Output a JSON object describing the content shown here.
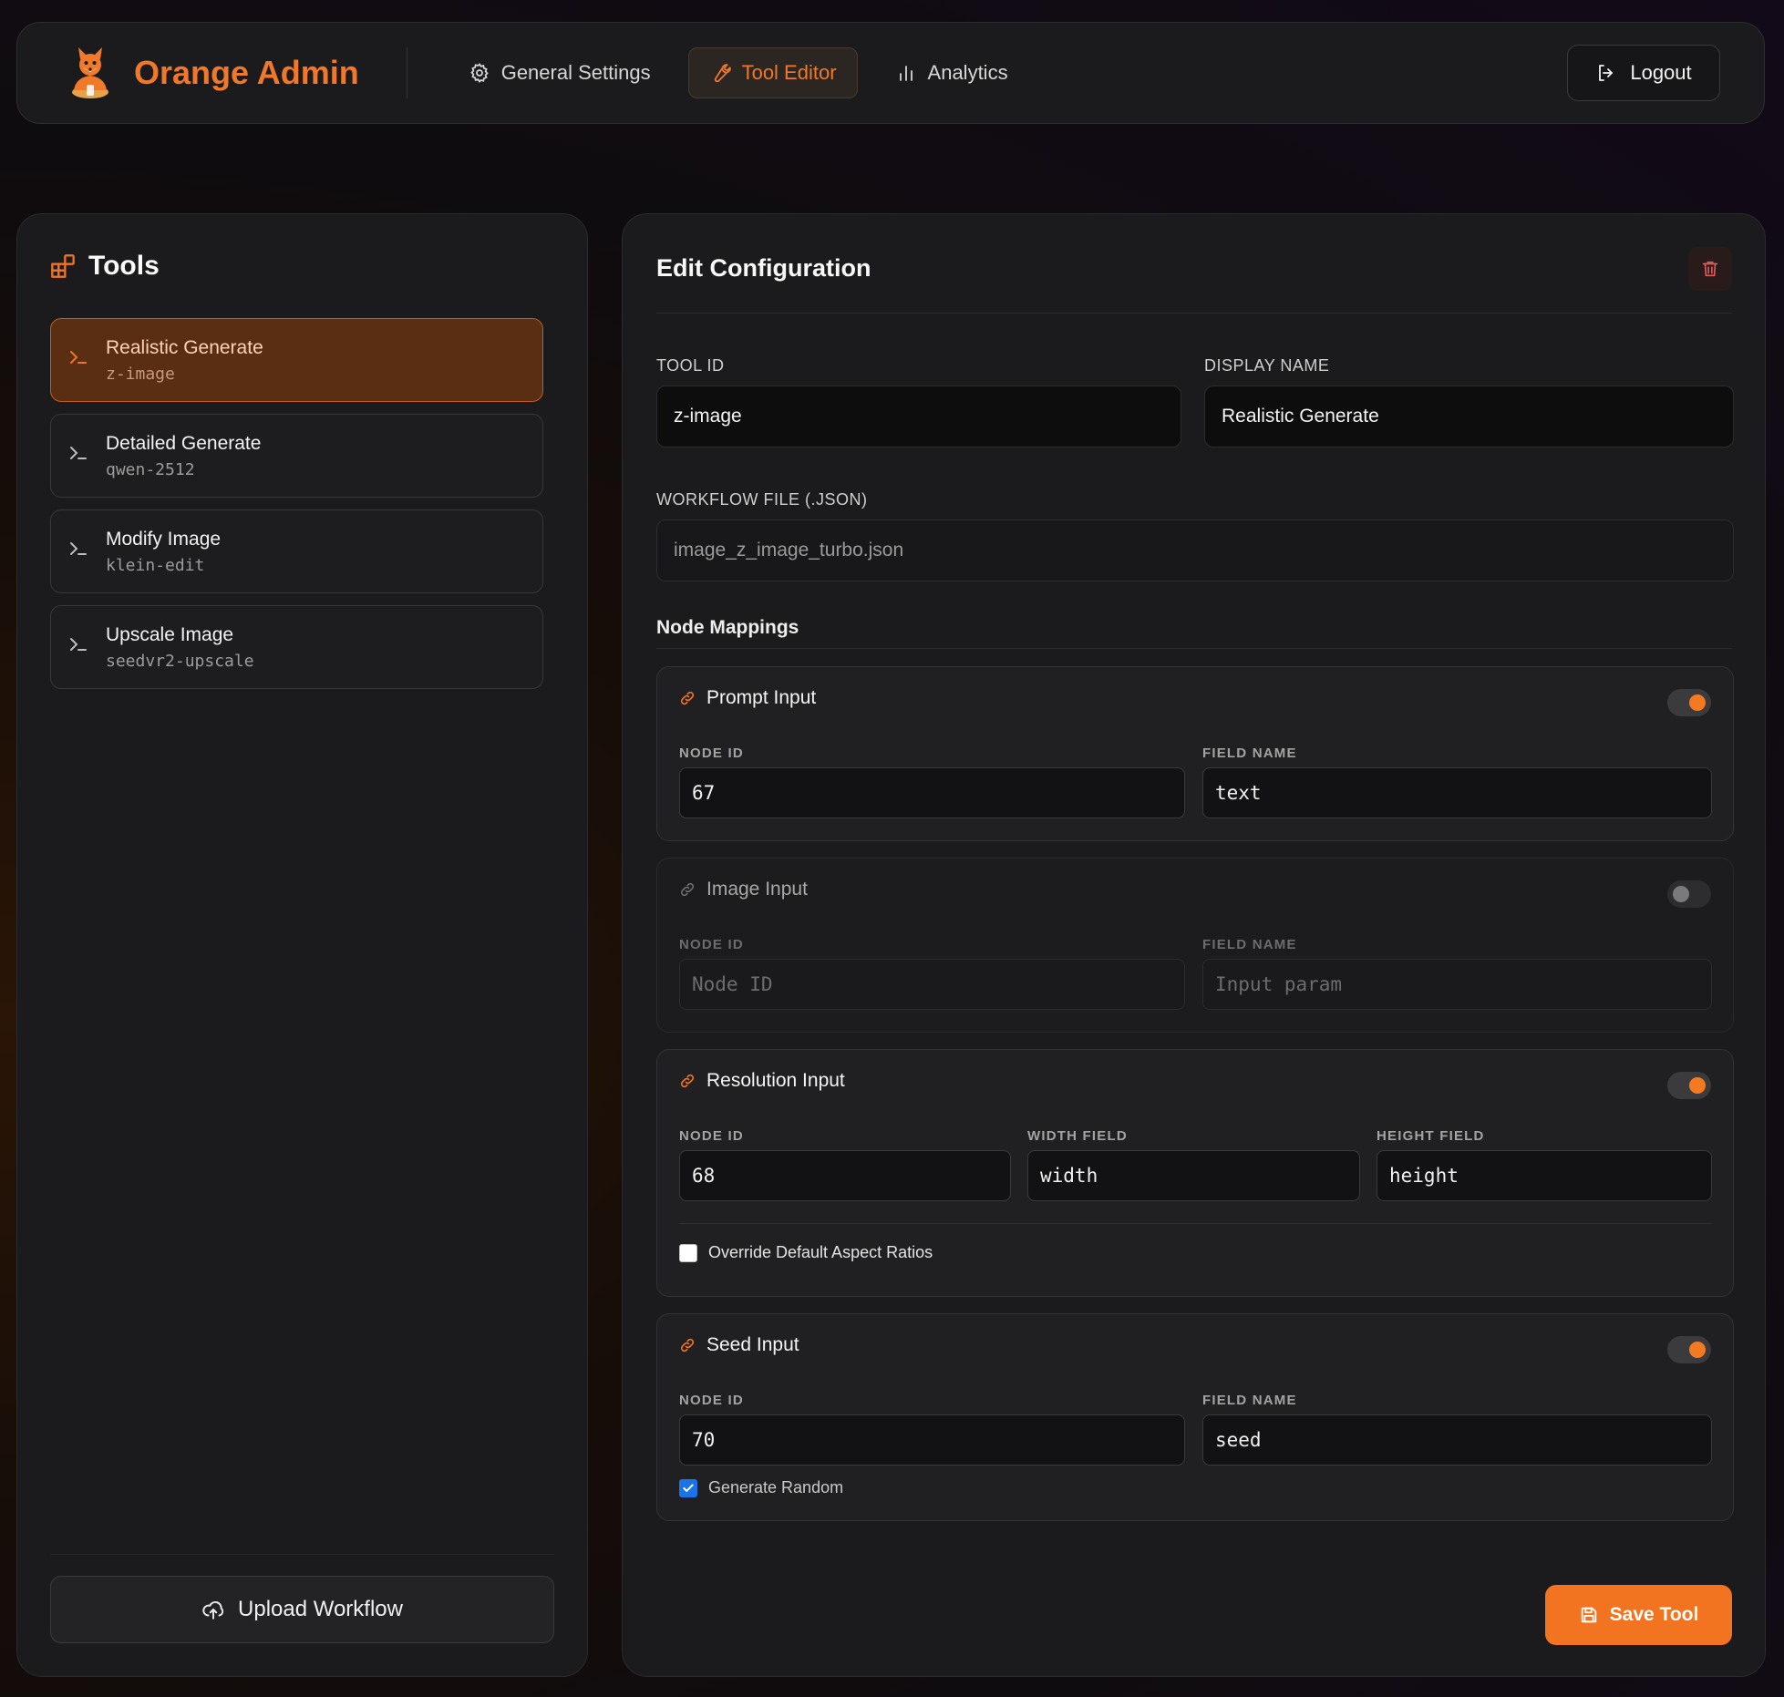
{
  "header": {
    "brand_title": "Orange Admin",
    "nav": [
      {
        "label": "General Settings",
        "icon": "gear-icon",
        "active": false
      },
      {
        "label": "Tool Editor",
        "icon": "wrench-icon",
        "active": true
      },
      {
        "label": "Analytics",
        "icon": "bar-chart-icon",
        "active": false
      }
    ],
    "logout_label": "Logout"
  },
  "sidebar": {
    "title": "Tools",
    "tools": [
      {
        "name": "Realistic Generate",
        "id": "z-image",
        "active": true
      },
      {
        "name": "Detailed Generate",
        "id": "qwen-2512",
        "active": false
      },
      {
        "name": "Modify Image",
        "id": "klein-edit",
        "active": false
      },
      {
        "name": "Upscale Image",
        "id": "seedvr2-upscale",
        "active": false
      }
    ],
    "upload_label": "Upload Workflow"
  },
  "editor": {
    "title": "Edit Configuration",
    "tool_id_label": "TOOL ID",
    "tool_id_value": "z-image",
    "display_name_label": "DISPLAY NAME",
    "display_name_value": "Realistic Generate",
    "workflow_label": "WORKFLOW FILE (.JSON)",
    "workflow_value": "image_z_image_turbo.json",
    "mappings_label": "Node Mappings",
    "mappings": {
      "prompt": {
        "title": "Prompt Input",
        "enabled": true,
        "node_id_label": "NODE ID",
        "node_id": "67",
        "field_label": "FIELD NAME",
        "field": "text"
      },
      "image": {
        "title": "Image Input",
        "enabled": false,
        "node_id_label": "NODE ID",
        "node_id_placeholder": "Node ID",
        "field_label": "FIELD NAME",
        "field_placeholder": "Input param"
      },
      "resolution": {
        "title": "Resolution Input",
        "enabled": true,
        "node_id_label": "NODE ID",
        "node_id": "68",
        "width_label": "WIDTH FIELD",
        "width": "width",
        "height_label": "HEIGHT FIELD",
        "height": "height",
        "override_label": "Override Default Aspect Ratios",
        "override_checked": false
      },
      "seed": {
        "title": "Seed Input",
        "enabled": true,
        "node_id_label": "NODE ID",
        "node_id": "70",
        "field_label": "FIELD NAME",
        "field": "seed",
        "random_label": "Generate Random",
        "random_checked": true
      }
    },
    "save_label": "Save Tool"
  },
  "colors": {
    "accent": "#f27420",
    "accent_dark": "#5a2e12",
    "checkbox": "#1a73e8",
    "danger": "#e05a5a"
  }
}
